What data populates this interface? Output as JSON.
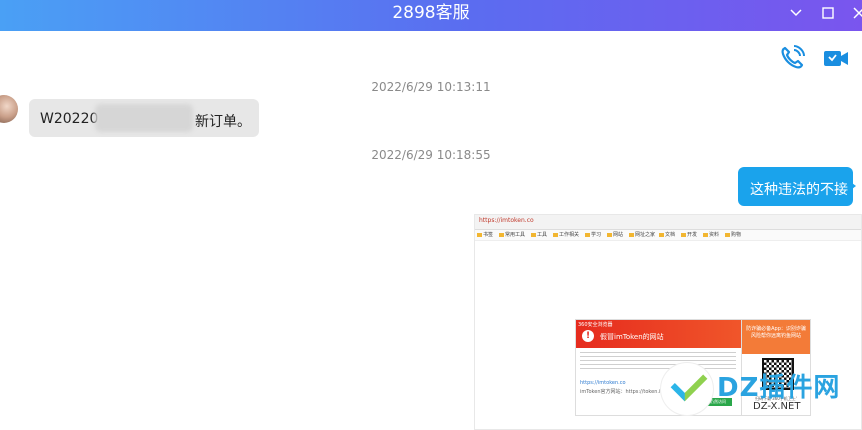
{
  "window": {
    "title": "2898客服",
    "collapse_icon": "chevron-down-icon",
    "maximize_icon": "maximize-icon",
    "close_icon": "close-icon"
  },
  "toolbar": {
    "voice_call_icon": "phone-call-icon",
    "video_call_icon": "video-call-icon",
    "accent_color": "#1a8ee0"
  },
  "messages": [
    {
      "timestamp": "2022/6/29 10:13:11",
      "direction": "incoming",
      "text_prefix": "W20220",
      "text_suffix": "新订单。",
      "redacted": true
    },
    {
      "timestamp": "2022/6/29 10:18:55",
      "direction": "outgoing",
      "text": "这种违法的不接"
    }
  ],
  "screenshot_attachment": {
    "warning": {
      "top_label": "360安全浏览器",
      "title": "假冒imToken的网站",
      "link": "https://imtoken.co",
      "link_label": "imToken官方网站：https://token.im",
      "button": "仍然访问"
    },
    "promo": {
      "text": "防诈骗必备App：识别诈骗风险帮你远离钓鱼网站",
      "footer": "扫码下载'360手机卫士'"
    },
    "bookmarks": [
      "书签",
      "常用工具",
      "工具",
      "工作相关",
      "学习",
      "网站",
      "网址之家",
      "文档",
      "开发",
      "资料",
      "购物"
    ]
  },
  "watermark": {
    "text": "DZ插件网",
    "sub": "DZ-X.NET"
  }
}
